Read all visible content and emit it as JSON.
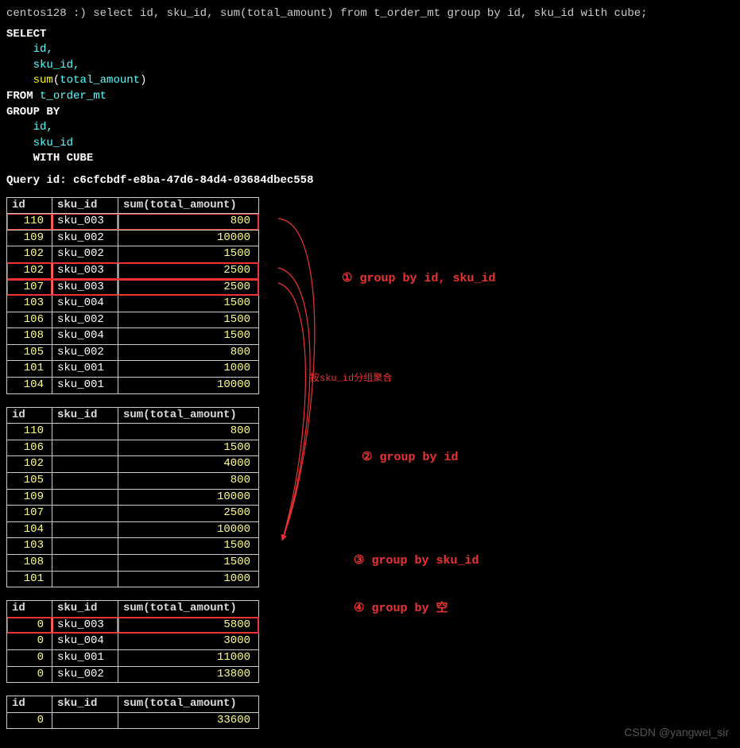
{
  "prompt": {
    "host": "centos128",
    "symbol": ":)",
    "command": "select id, sku_id, sum(total_amount) from t_order_mt group by id, sku_id with cube;"
  },
  "sql": {
    "select": "SELECT",
    "col1": "id,",
    "col2": "sku_id,",
    "fn_name": "sum",
    "lparen": "(",
    "fn_arg": "total_amount",
    "rparen": ")",
    "from": "FROM",
    "table": "t_order_mt",
    "group_by": "GROUP BY",
    "gb_col1": "id,",
    "gb_col2": "sku_id",
    "with_cube": "WITH CUBE"
  },
  "query_id": {
    "label": "Query id:",
    "value": "c6cfcbdf-e8ba-47d6-84d4-03684dbec558"
  },
  "headers": {
    "id": "id",
    "sku_id": "sku_id",
    "sum": "sum(total_amount)"
  },
  "chart_data": {
    "type": "table",
    "title": "WITH CUBE results",
    "tables": [
      {
        "group_level": "id, sku_id",
        "rows": [
          {
            "id": "110",
            "sku": "sku_003",
            "sum": "800",
            "hl": true
          },
          {
            "id": "109",
            "sku": "sku_002",
            "sum": "10000"
          },
          {
            "id": "102",
            "sku": "sku_002",
            "sum": "1500"
          },
          {
            "id": "102",
            "sku": "sku_003",
            "sum": "2500",
            "hl": true
          },
          {
            "id": "107",
            "sku": "sku_003",
            "sum": "2500",
            "hl": true
          },
          {
            "id": "103",
            "sku": "sku_004",
            "sum": "1500"
          },
          {
            "id": "106",
            "sku": "sku_002",
            "sum": "1500"
          },
          {
            "id": "108",
            "sku": "sku_004",
            "sum": "1500"
          },
          {
            "id": "105",
            "sku": "sku_002",
            "sum": "800"
          },
          {
            "id": "101",
            "sku": "sku_001",
            "sum": "1000"
          },
          {
            "id": "104",
            "sku": "sku_001",
            "sum": "10000"
          }
        ]
      },
      {
        "group_level": "id",
        "rows": [
          {
            "id": "110",
            "sku": "",
            "sum": "800"
          },
          {
            "id": "106",
            "sku": "",
            "sum": "1500"
          },
          {
            "id": "102",
            "sku": "",
            "sum": "4000"
          },
          {
            "id": "105",
            "sku": "",
            "sum": "800"
          },
          {
            "id": "109",
            "sku": "",
            "sum": "10000"
          },
          {
            "id": "107",
            "sku": "",
            "sum": "2500"
          },
          {
            "id": "104",
            "sku": "",
            "sum": "10000"
          },
          {
            "id": "103",
            "sku": "",
            "sum": "1500"
          },
          {
            "id": "108",
            "sku": "",
            "sum": "1500"
          },
          {
            "id": "101",
            "sku": "",
            "sum": "1000"
          }
        ]
      },
      {
        "group_level": "sku_id",
        "rows": [
          {
            "id": "0",
            "sku": "sku_003",
            "sum": "5800",
            "hl": true
          },
          {
            "id": "0",
            "sku": "sku_004",
            "sum": "3000"
          },
          {
            "id": "0",
            "sku": "sku_001",
            "sum": "11000"
          },
          {
            "id": "0",
            "sku": "sku_002",
            "sum": "13800"
          }
        ]
      },
      {
        "group_level": "empty",
        "rows": [
          {
            "id": "0",
            "sku": "",
            "sum": "33600"
          }
        ]
      }
    ]
  },
  "annotations": {
    "a1": "① group by id, sku_id",
    "a2": "② group by id",
    "a3": "③ group by sku_id",
    "a4": "④ group by 空",
    "mid": "按sku_id分组聚合"
  },
  "watermark": "CSDN @yangwei_sir"
}
